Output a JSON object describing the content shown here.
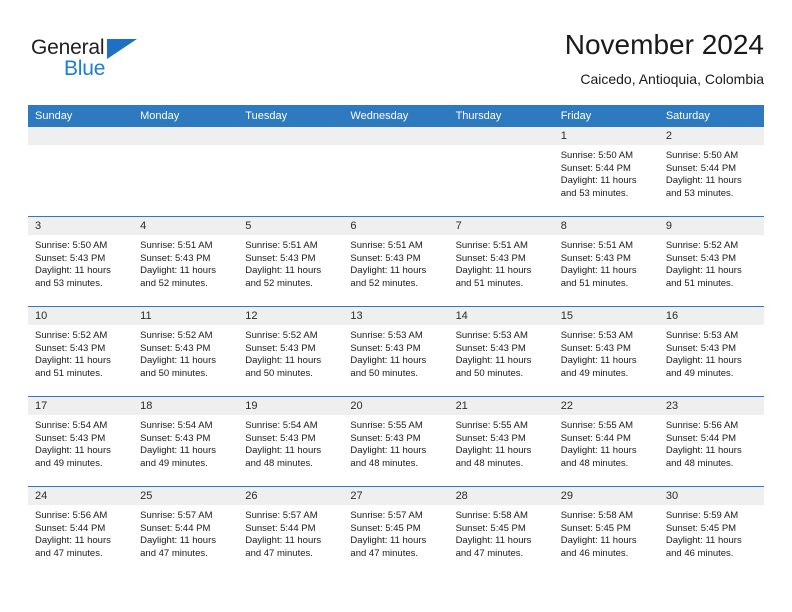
{
  "brand": {
    "name_part1": "General",
    "name_part2": "Blue",
    "triangle_color": "#1f6fc4",
    "blue_color": "#1a7fd4"
  },
  "header": {
    "title": "November 2024",
    "subtitle": "Caicedo, Antioquia, Colombia"
  },
  "theme": {
    "header_blue": "#2e7ac0",
    "daynum_band": "#efefef",
    "text": "#1a1a1a"
  },
  "weekdays": [
    "Sunday",
    "Monday",
    "Tuesday",
    "Wednesday",
    "Thursday",
    "Friday",
    "Saturday"
  ],
  "weeks": [
    [
      {
        "day": "",
        "sunrise": "",
        "sunset": "",
        "daylight_line1": "",
        "daylight_line2": ""
      },
      {
        "day": "",
        "sunrise": "",
        "sunset": "",
        "daylight_line1": "",
        "daylight_line2": ""
      },
      {
        "day": "",
        "sunrise": "",
        "sunset": "",
        "daylight_line1": "",
        "daylight_line2": ""
      },
      {
        "day": "",
        "sunrise": "",
        "sunset": "",
        "daylight_line1": "",
        "daylight_line2": ""
      },
      {
        "day": "",
        "sunrise": "",
        "sunset": "",
        "daylight_line1": "",
        "daylight_line2": ""
      },
      {
        "day": "1",
        "sunrise": "Sunrise: 5:50 AM",
        "sunset": "Sunset: 5:44 PM",
        "daylight_line1": "Daylight: 11 hours",
        "daylight_line2": "and 53 minutes."
      },
      {
        "day": "2",
        "sunrise": "Sunrise: 5:50 AM",
        "sunset": "Sunset: 5:44 PM",
        "daylight_line1": "Daylight: 11 hours",
        "daylight_line2": "and 53 minutes."
      }
    ],
    [
      {
        "day": "3",
        "sunrise": "Sunrise: 5:50 AM",
        "sunset": "Sunset: 5:43 PM",
        "daylight_line1": "Daylight: 11 hours",
        "daylight_line2": "and 53 minutes."
      },
      {
        "day": "4",
        "sunrise": "Sunrise: 5:51 AM",
        "sunset": "Sunset: 5:43 PM",
        "daylight_line1": "Daylight: 11 hours",
        "daylight_line2": "and 52 minutes."
      },
      {
        "day": "5",
        "sunrise": "Sunrise: 5:51 AM",
        "sunset": "Sunset: 5:43 PM",
        "daylight_line1": "Daylight: 11 hours",
        "daylight_line2": "and 52 minutes."
      },
      {
        "day": "6",
        "sunrise": "Sunrise: 5:51 AM",
        "sunset": "Sunset: 5:43 PM",
        "daylight_line1": "Daylight: 11 hours",
        "daylight_line2": "and 52 minutes."
      },
      {
        "day": "7",
        "sunrise": "Sunrise: 5:51 AM",
        "sunset": "Sunset: 5:43 PM",
        "daylight_line1": "Daylight: 11 hours",
        "daylight_line2": "and 51 minutes."
      },
      {
        "day": "8",
        "sunrise": "Sunrise: 5:51 AM",
        "sunset": "Sunset: 5:43 PM",
        "daylight_line1": "Daylight: 11 hours",
        "daylight_line2": "and 51 minutes."
      },
      {
        "day": "9",
        "sunrise": "Sunrise: 5:52 AM",
        "sunset": "Sunset: 5:43 PM",
        "daylight_line1": "Daylight: 11 hours",
        "daylight_line2": "and 51 minutes."
      }
    ],
    [
      {
        "day": "10",
        "sunrise": "Sunrise: 5:52 AM",
        "sunset": "Sunset: 5:43 PM",
        "daylight_line1": "Daylight: 11 hours",
        "daylight_line2": "and 51 minutes."
      },
      {
        "day": "11",
        "sunrise": "Sunrise: 5:52 AM",
        "sunset": "Sunset: 5:43 PM",
        "daylight_line1": "Daylight: 11 hours",
        "daylight_line2": "and 50 minutes."
      },
      {
        "day": "12",
        "sunrise": "Sunrise: 5:52 AM",
        "sunset": "Sunset: 5:43 PM",
        "daylight_line1": "Daylight: 11 hours",
        "daylight_line2": "and 50 minutes."
      },
      {
        "day": "13",
        "sunrise": "Sunrise: 5:53 AM",
        "sunset": "Sunset: 5:43 PM",
        "daylight_line1": "Daylight: 11 hours",
        "daylight_line2": "and 50 minutes."
      },
      {
        "day": "14",
        "sunrise": "Sunrise: 5:53 AM",
        "sunset": "Sunset: 5:43 PM",
        "daylight_line1": "Daylight: 11 hours",
        "daylight_line2": "and 50 minutes."
      },
      {
        "day": "15",
        "sunrise": "Sunrise: 5:53 AM",
        "sunset": "Sunset: 5:43 PM",
        "daylight_line1": "Daylight: 11 hours",
        "daylight_line2": "and 49 minutes."
      },
      {
        "day": "16",
        "sunrise": "Sunrise: 5:53 AM",
        "sunset": "Sunset: 5:43 PM",
        "daylight_line1": "Daylight: 11 hours",
        "daylight_line2": "and 49 minutes."
      }
    ],
    [
      {
        "day": "17",
        "sunrise": "Sunrise: 5:54 AM",
        "sunset": "Sunset: 5:43 PM",
        "daylight_line1": "Daylight: 11 hours",
        "daylight_line2": "and 49 minutes."
      },
      {
        "day": "18",
        "sunrise": "Sunrise: 5:54 AM",
        "sunset": "Sunset: 5:43 PM",
        "daylight_line1": "Daylight: 11 hours",
        "daylight_line2": "and 49 minutes."
      },
      {
        "day": "19",
        "sunrise": "Sunrise: 5:54 AM",
        "sunset": "Sunset: 5:43 PM",
        "daylight_line1": "Daylight: 11 hours",
        "daylight_line2": "and 48 minutes."
      },
      {
        "day": "20",
        "sunrise": "Sunrise: 5:55 AM",
        "sunset": "Sunset: 5:43 PM",
        "daylight_line1": "Daylight: 11 hours",
        "daylight_line2": "and 48 minutes."
      },
      {
        "day": "21",
        "sunrise": "Sunrise: 5:55 AM",
        "sunset": "Sunset: 5:43 PM",
        "daylight_line1": "Daylight: 11 hours",
        "daylight_line2": "and 48 minutes."
      },
      {
        "day": "22",
        "sunrise": "Sunrise: 5:55 AM",
        "sunset": "Sunset: 5:44 PM",
        "daylight_line1": "Daylight: 11 hours",
        "daylight_line2": "and 48 minutes."
      },
      {
        "day": "23",
        "sunrise": "Sunrise: 5:56 AM",
        "sunset": "Sunset: 5:44 PM",
        "daylight_line1": "Daylight: 11 hours",
        "daylight_line2": "and 48 minutes."
      }
    ],
    [
      {
        "day": "24",
        "sunrise": "Sunrise: 5:56 AM",
        "sunset": "Sunset: 5:44 PM",
        "daylight_line1": "Daylight: 11 hours",
        "daylight_line2": "and 47 minutes."
      },
      {
        "day": "25",
        "sunrise": "Sunrise: 5:57 AM",
        "sunset": "Sunset: 5:44 PM",
        "daylight_line1": "Daylight: 11 hours",
        "daylight_line2": "and 47 minutes."
      },
      {
        "day": "26",
        "sunrise": "Sunrise: 5:57 AM",
        "sunset": "Sunset: 5:44 PM",
        "daylight_line1": "Daylight: 11 hours",
        "daylight_line2": "and 47 minutes."
      },
      {
        "day": "27",
        "sunrise": "Sunrise: 5:57 AM",
        "sunset": "Sunset: 5:45 PM",
        "daylight_line1": "Daylight: 11 hours",
        "daylight_line2": "and 47 minutes."
      },
      {
        "day": "28",
        "sunrise": "Sunrise: 5:58 AM",
        "sunset": "Sunset: 5:45 PM",
        "daylight_line1": "Daylight: 11 hours",
        "daylight_line2": "and 47 minutes."
      },
      {
        "day": "29",
        "sunrise": "Sunrise: 5:58 AM",
        "sunset": "Sunset: 5:45 PM",
        "daylight_line1": "Daylight: 11 hours",
        "daylight_line2": "and 46 minutes."
      },
      {
        "day": "30",
        "sunrise": "Sunrise: 5:59 AM",
        "sunset": "Sunset: 5:45 PM",
        "daylight_line1": "Daylight: 11 hours",
        "daylight_line2": "and 46 minutes."
      }
    ]
  ]
}
